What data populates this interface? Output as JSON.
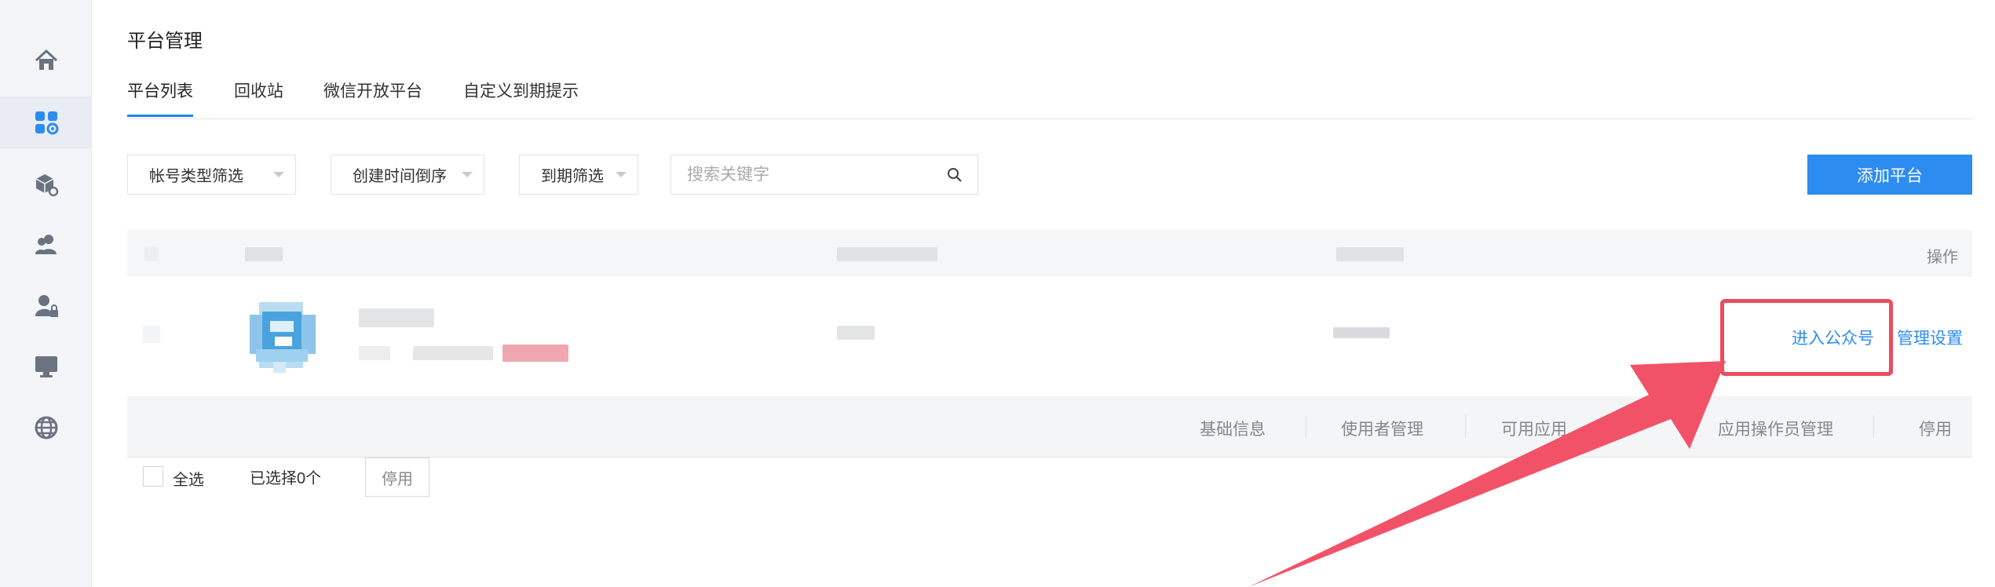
{
  "page": {
    "title": "平台管理"
  },
  "tabs": [
    {
      "label": "平台列表",
      "active": true
    },
    {
      "label": "回收站"
    },
    {
      "label": "微信开放平台"
    },
    {
      "label": "自定义到期提示"
    }
  ],
  "filters": {
    "account_type": "帐号类型筛选",
    "sort": "创建时间倒序",
    "expiry": "到期筛选",
    "search_placeholder": "搜索关键字",
    "add_button": "添加平台"
  },
  "table": {
    "operation_header": "操作",
    "row": {
      "enter_link": "进入公众号",
      "manage_link": "管理设置"
    },
    "subactions": [
      "基础信息",
      "使用者管理",
      "可用应用",
      "应用操作员管理",
      "停用"
    ]
  },
  "bottom": {
    "select_all": "全选",
    "selected_count": "已选择0个",
    "disable_button": "停用"
  },
  "colors": {
    "accent": "#2d8cf0",
    "highlight": "#ee4b5f",
    "sidebar_bg": "#f4f5f9"
  },
  "sidebar": {
    "icons": [
      "home-icon",
      "apps-settings-icon",
      "package-settings-icon",
      "users-icon",
      "user-lock-icon",
      "monitor-icon",
      "globe-icon"
    ],
    "active_index": 1
  }
}
